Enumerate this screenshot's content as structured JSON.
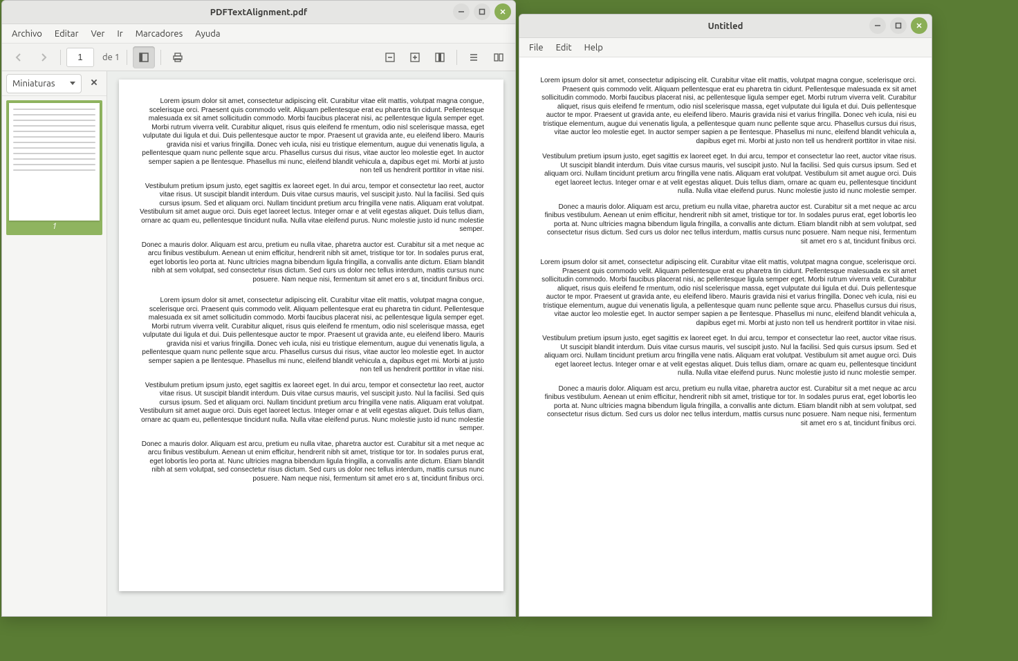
{
  "pdf": {
    "title": "PDFTextAlignment.pdf",
    "menu": {
      "file": "Archivo",
      "edit": "Editar",
      "view": "Ver",
      "go": "Ir",
      "bookmarks": "Marcadores",
      "help": "Ayuda"
    },
    "toolbar": {
      "page_value": "1",
      "page_of": "de 1"
    },
    "side": {
      "combo_label": "Miniaturas",
      "thumb_number": "1"
    },
    "paragraphs": [
      "Lorem ipsum dolor sit amet, consectetur adipiscing elit. Curabitur vitae elit mattis, volutpat magna congue, scelerisque orci. Praesent quis commodo velit. Aliquam pellentesque erat eu pharetra tin cidunt. Pellentesque malesuada ex sit amet sollicitudin commodo. Morbi faucibus placerat nisi, ac pellentesque ligula semper eget. Morbi rutrum viverra velit. Curabitur aliquet, risus quis eleifend fe rmentum, odio nisl scelerisque massa, eget vulputate dui ligula et dui. Duis pellentesque auctor te mpor. Praesent ut gravida ante, eu eleifend libero. Mauris gravida nisi et varius fringilla. Donec veh icula, nisi eu tristique elementum, augue dui venenatis ligula, a pellentesque quam nunc pellente sque arcu. Phasellus cursus dui risus, vitae auctor leo molestie eget. In auctor semper sapien a pe llentesque. Phasellus mi nunc, eleifend blandit vehicula a, dapibus eget mi. Morbi at justo non tell us hendrerit porttitor in vitae nisi.",
      "Vestibulum pretium ipsum justo, eget sagittis ex laoreet eget. In dui arcu, tempor et consectetur lao reet, auctor vitae risus. Ut suscipit blandit interdum. Duis vitae cursus mauris, vel suscipit justo. Nul la facilisi. Sed quis cursus ipsum. Sed et aliquam orci. Nullam tincidunt pretium arcu fringilla vene natis. Aliquam erat volutpat. Vestibulum sit amet augue orci. Duis eget laoreet lectus. Integer ornar e at velit egestas aliquet. Duis tellus diam, ornare ac quam eu, pellentesque tincidunt nulla. Nulla vitae eleifend purus. Nunc molestie justo id nunc molestie semper.",
      "Donec a mauris dolor. Aliquam est arcu, pretium eu nulla vitae, pharetra auctor est. Curabitur sit a met neque ac arcu finibus vestibulum. Aenean ut enim efficitur, hendrerit nibh sit amet, tristique tor tor. In sodales purus erat, eget lobortis leo porta at. Nunc ultricies magna bibendum ligula fringilla, a convallis ante dictum. Etiam blandit nibh at sem volutpat, sed consectetur risus dictum. Sed curs us dolor nec tellus interdum, mattis cursus nunc posuere. Nam neque nisi, fermentum sit amet ero s at, tincidunt finibus orci.",
      "Lorem ipsum dolor sit amet, consectetur adipiscing elit. Curabitur vitae elit mattis, volutpat magna congue, scelerisque orci. Praesent quis commodo velit. Aliquam pellentesque erat eu pharetra tin cidunt. Pellentesque malesuada ex sit amet sollicitudin commodo. Morbi faucibus placerat nisi, ac pellentesque ligula semper eget. Morbi rutrum viverra velit. Curabitur aliquet, risus quis eleifend fe rmentum, odio nisl scelerisque massa, eget vulputate dui ligula et dui. Duis pellentesque auctor te mpor. Praesent ut gravida ante, eu eleifend libero. Mauris gravida nisi et varius fringilla. Donec veh icula, nisi eu tristique elementum, augue dui venenatis ligula, a pellentesque quam nunc pellente sque arcu. Phasellus cursus dui risus, vitae auctor leo molestie eget. In auctor semper sapien a pe llentesque. Phasellus mi nunc, eleifend blandit vehicula a, dapibus eget mi. Morbi at justo non tell us hendrerit porttitor in vitae nisi.",
      "Vestibulum pretium ipsum justo, eget sagittis ex laoreet eget. In dui arcu, tempor et consectetur lao reet, auctor vitae risus. Ut suscipit blandit interdum. Duis vitae cursus mauris, vel suscipit justo. Nul la facilisi. Sed quis cursus ipsum. Sed et aliquam orci. Nullam tincidunt pretium arcu fringilla vene natis. Aliquam erat volutpat. Vestibulum sit amet augue orci. Duis eget laoreet lectus. Integer ornar e at velit egestas aliquet. Duis tellus diam, ornare ac quam eu, pellentesque tincidunt nulla. Nulla vitae eleifend purus. Nunc molestie justo id nunc molestie semper.",
      "Donec a mauris dolor. Aliquam est arcu, pretium eu nulla vitae, pharetra auctor est. Curabitur sit a met neque ac arcu finibus vestibulum. Aenean ut enim efficitur, hendrerit nibh sit amet, tristique tor tor. In sodales purus erat, eget lobortis leo porta at. Nunc ultricies magna bibendum ligula fringilla, a convallis ante dictum. Etiam blandit nibh at sem volutpat, sed consectetur risus dictum. Sed curs us dolor nec tellus interdum, mattis cursus nunc posuere. Nam neque nisi, fermentum sit amet ero s at, tincidunt finibus orci."
    ]
  },
  "editor": {
    "title": "Untitled",
    "menu": {
      "file": "File",
      "edit": "Edit",
      "help": "Help"
    },
    "paragraphs": [
      "Lorem ipsum dolor sit amet, consectetur adipiscing elit. Curabitur vitae elit mattis, volutpat magna congue, scelerisque orci. Praesent quis commodo velit. Aliquam pellentesque erat eu pharetra tin cidunt. Pellentesque malesuada ex sit amet sollicitudin commodo. Morbi faucibus placerat nisi, ac pellentesque ligula semper eget. Morbi rutrum viverra velit. Curabitur aliquet, risus quis eleifend fe rmentum, odio nisl scelerisque massa, eget vulputate dui ligula et dui. Duis pellentesque auctor te mpor. Praesent ut gravida ante, eu eleifend libero. Mauris gravida nisi et varius fringilla. Donec veh icula, nisi eu tristique elementum, augue dui venenatis ligula, a pellentesque quam nunc pellente sque arcu. Phasellus cursus dui risus, vitae auctor leo molestie eget. In auctor semper sapien a pe llentesque. Phasellus mi nunc, eleifend blandit vehicula a, dapibus eget mi. Morbi at justo non tell us hendrerit porttitor in vitae nisi.",
      "Vestibulum pretium ipsum justo, eget sagittis ex laoreet eget. In dui arcu, tempor et consectetur lao reet, auctor vitae risus. Ut suscipit blandit interdum. Duis vitae cursus mauris, vel suscipit justo. Nul la facilisi. Sed quis cursus ipsum. Sed et aliquam orci. Nullam tincidunt pretium arcu fringilla vene natis. Aliquam erat volutpat. Vestibulum sit amet augue orci. Duis eget laoreet lectus. Integer ornar e at velit egestas aliquet. Duis tellus diam, ornare ac quam eu, pellentesque tincidunt nulla. Nulla vitae eleifend purus. Nunc molestie justo id nunc molestie semper.",
      "Donec a mauris dolor. Aliquam est arcu, pretium eu nulla vitae, pharetra auctor est. Curabitur sit a met neque ac arcu finibus vestibulum. Aenean ut enim efficitur, hendrerit nibh sit amet, tristique tor tor. In sodales purus erat, eget lobortis leo porta at. Nunc ultricies magna bibendum ligula fringilla, a convallis ante dictum. Etiam blandit nibh at sem volutpat, sed consectetur risus dictum. Sed curs us dolor nec tellus interdum, mattis cursus nunc posuere. Nam neque nisi, fermentum sit amet ero s at, tincidunt finibus orci.",
      "Lorem ipsum dolor sit amet, consectetur adipiscing elit. Curabitur vitae elit mattis, volutpat magna congue, scelerisque orci. Praesent quis commodo velit. Aliquam pellentesque erat eu pharetra tin cidunt. Pellentesque malesuada ex sit amet sollicitudin commodo. Morbi faucibus placerat nisi, ac pellentesque ligula semper eget. Morbi rutrum viverra velit. Curabitur aliquet, risus quis eleifend fe rmentum, odio nisl scelerisque massa, eget vulputate dui ligula et dui. Duis pellentesque auctor te mpor. Praesent ut gravida ante, eu eleifend libero. Mauris gravida nisi et varius fringilla. Donec veh icula, nisi eu tristique elementum, augue dui venenatis ligula, a pellentesque quam nunc pellente sque arcu. Phasellus cursus dui risus, vitae auctor leo molestie eget. In auctor semper sapien a pe llentesque. Phasellus mi nunc, eleifend blandit vehicula a, dapibus eget mi. Morbi at justo non tell us hendrerit porttitor in vitae nisi.",
      "Vestibulum pretium ipsum justo, eget sagittis ex laoreet eget. In dui arcu, tempor et consectetur lao reet, auctor vitae risus. Ut suscipit blandit interdum. Duis vitae cursus mauris, vel suscipit justo. Nul la facilisi. Sed quis cursus ipsum. Sed et aliquam orci. Nullam tincidunt pretium arcu fringilla vene natis. Aliquam erat volutpat. Vestibulum sit amet augue orci. Duis eget laoreet lectus. Integer ornar e at velit egestas aliquet. Duis tellus diam, ornare ac quam eu, pellentesque tincidunt nulla. Nulla vitae eleifend purus. Nunc molestie justo id nunc molestie semper.",
      "Donec a mauris dolor. Aliquam est arcu, pretium eu nulla vitae, pharetra auctor est. Curabitur sit a met neque ac arcu finibus vestibulum. Aenean ut enim efficitur, hendrerit nibh sit amet, tristique tor tor. In sodales purus erat, eget lobortis leo porta at. Nunc ultricies magna bibendum ligula fringilla, a convallis ante dictum. Etiam blandit nibh at sem volutpat, sed consectetur risus dictum. Sed curs us dolor nec tellus interdum, mattis cursus nunc posuere. Nam neque nisi, fermentum sit amet ero s at, tincidunt finibus orci."
    ]
  }
}
